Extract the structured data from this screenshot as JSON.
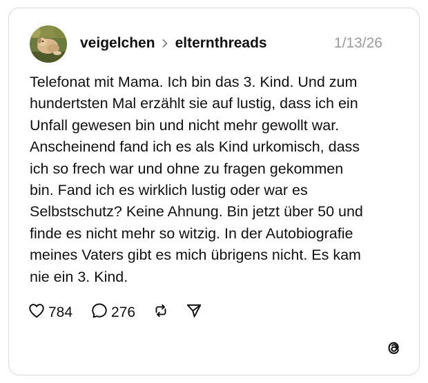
{
  "post": {
    "author": "veigelchen",
    "community": "elternthreads",
    "date": "1/13/26",
    "text": "Telefonat mit Mama. Ich bin das 3. Kind. Und zum\nhundertsten Mal erzählt sie auf lustig, dass ich ein\nUnfall gewesen bin und nicht mehr gewollt war.\nAnscheinend fand ich es als Kind urkomisch, dass\nich so frech war und ohne zu fragen gekommen\nbin. Fand ich es wirklich lustig oder war es\nSelbstschutz? Keine Ahnung. Bin jetzt über 50 und\nfinde es nicht mehr so witzig. In der Autobiografie\nmeines Vaters gibt es mich übrigens nicht. Es kam\nnie ein 3. Kind."
  },
  "actions": {
    "likes": "784",
    "replies": "276"
  },
  "icons": {
    "avatar": "avatar-photo-dog",
    "separator": "chevron-right-icon",
    "like": "heart-icon",
    "reply": "speech-bubble-icon",
    "repost": "repost-icon",
    "share": "paper-plane-icon",
    "brand": "threads-logo-icon"
  },
  "colors": {
    "text": "#101010",
    "muted": "#9a9a9a",
    "border": "#d9d9d9"
  }
}
